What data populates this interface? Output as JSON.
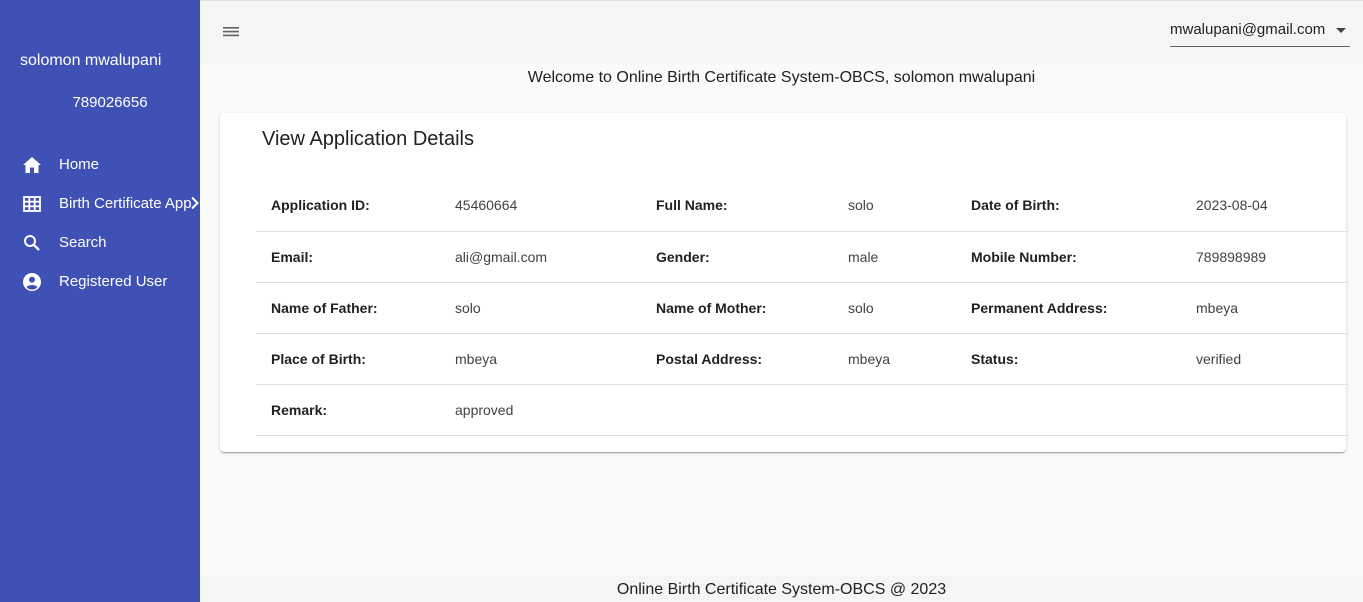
{
  "sidebar": {
    "user_name": "solomon mwalupani",
    "user_phone": "789026656",
    "items": [
      {
        "label": "Home",
        "icon": "home-icon"
      },
      {
        "label": "Birth Certificate App",
        "icon": "grid-icon"
      },
      {
        "label": "Search",
        "icon": "search-icon"
      },
      {
        "label": "Registered User",
        "icon": "account-circle-icon"
      }
    ]
  },
  "topbar": {
    "account_email": "mwalupani@gmail.com"
  },
  "welcome_text": "Welcome to Online Birth Certificate System-OBCS, solomon mwalupani",
  "card": {
    "title": "View Application Details",
    "rows": [
      [
        {
          "label": "Application ID:",
          "value": "45460664"
        },
        {
          "label": "Full Name:",
          "value": "solo"
        },
        {
          "label": "Date of Birth:",
          "value": "2023-08-04"
        }
      ],
      [
        {
          "label": "Email:",
          "value": "ali@gmail.com"
        },
        {
          "label": "Gender:",
          "value": "male"
        },
        {
          "label": "Mobile Number:",
          "value": "789898989"
        }
      ],
      [
        {
          "label": "Name of Father:",
          "value": "solo"
        },
        {
          "label": "Name of Mother:",
          "value": "solo"
        },
        {
          "label": "Permanent Address:",
          "value": "mbeya"
        }
      ],
      [
        {
          "label": "Place of Birth:",
          "value": "mbeya"
        },
        {
          "label": "Postal Address:",
          "value": "mbeya"
        },
        {
          "label": "Status:",
          "value": "verified"
        }
      ],
      [
        {
          "label": "Remark:",
          "value": "approved"
        }
      ]
    ]
  },
  "footer_text": "Online Birth Certificate System-OBCS @ 2023",
  "colors": {
    "sidebar_bg": "#3f51b5",
    "topbar_bg": "#f5f5f5",
    "page_bg": "#fafafa"
  }
}
